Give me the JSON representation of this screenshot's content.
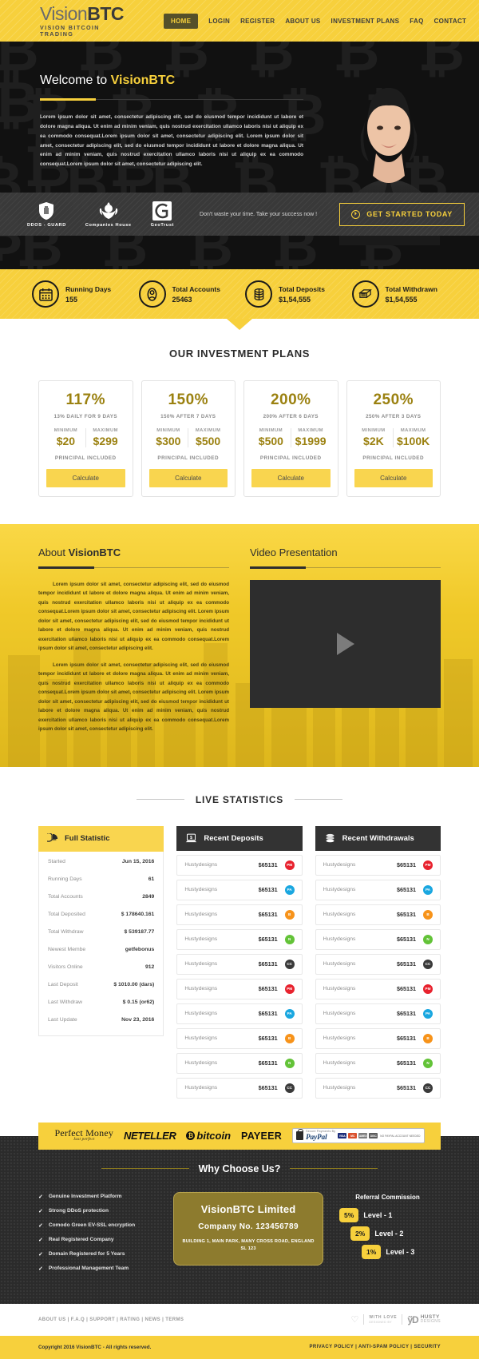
{
  "brand": {
    "logo_main_vision": "Vision",
    "logo_main_btc": "BTC",
    "logo_sub": "VISION BITCOIN TRADING",
    "accent": "#f7d03c",
    "dark": "#2b2b2b"
  },
  "nav": {
    "items": [
      {
        "label": "HOME",
        "active": true
      },
      {
        "label": "LOGIN",
        "active": false
      },
      {
        "label": "REGISTER",
        "active": false
      },
      {
        "label": "ABOUT US",
        "active": false
      },
      {
        "label": "INVESTMENT PLANS",
        "active": false
      },
      {
        "label": "FAQ",
        "active": false
      },
      {
        "label": "CONTACT",
        "active": false
      }
    ]
  },
  "hero": {
    "title_prefix": "Welcome to ",
    "title_brand": "VisionBTC",
    "paragraph": "Lorem ipsum dolor sit amet, consectetur adipiscing elit, sed do eiusmod tempor incididunt ut labore et dolore magna aliqua. Ut enim ad minim veniam, quis nostrud exercitation ullamco laboris nisi ut aliquip ex ea commodo consequat.Lorem ipsum dolor sit amet, consectetur adipiscing elit. Lorem ipsum dolor sit amet, consectetur adipiscing elit, sed do eiusmod tempor incididunt ut labore et dolore magna aliqua. Ut enim ad minim veniam, quis nostrud exercitation ullamco laboris nisi ut aliquip ex ea commodo consequat.Lorem ipsum dolor sit amet, consectetur adipiscing elit."
  },
  "trustbar": {
    "badges": [
      {
        "name": "DDOS - GUARD",
        "icon": "shield-icon"
      },
      {
        "name": "Companies House",
        "icon": "crest-icon"
      },
      {
        "name": "GeoTrust",
        "icon": "geotrust-icon"
      }
    ],
    "tagline": "Don't waste your time. Take your success now !",
    "cta_label": "GET STARTED TODAY"
  },
  "stats": [
    {
      "icon": "calendar-icon",
      "label": "Running Days",
      "value": "155"
    },
    {
      "icon": "user-icon",
      "label": "Total Accounts",
      "value": "25463"
    },
    {
      "icon": "coins-icon",
      "label": "Total Deposits",
      "value": "$1,54,555"
    },
    {
      "icon": "cash-stack-icon",
      "label": "Total Withdrawn",
      "value": "$1,54,555"
    }
  ],
  "plans_section": {
    "title": "OUR INVESTMENT PLANS",
    "min_label": "MINIMUM",
    "max_label": "MAXIMUM",
    "principal_label": "PRINCIPAL INCLUDED",
    "button_label": "Calculate",
    "plans": [
      {
        "percent": "117%",
        "desc": "13% DAILY FOR 9 DAYS",
        "min": "$20",
        "max": "$299"
      },
      {
        "percent": "150%",
        "desc": "150% AFTER 7 DAYS",
        "min": "$300",
        "max": "$500"
      },
      {
        "percent": "200%",
        "desc": "200% AFTER 6 DAYS",
        "min": "$500",
        "max": "$1999"
      },
      {
        "percent": "250%",
        "desc": "250% AFTER 3 DAYS",
        "min": "$2K",
        "max": "$100K"
      }
    ]
  },
  "about": {
    "heading_prefix": "About ",
    "heading_brand": "VisionBTC",
    "paragraph1": "Lorem ipsum dolor sit amet, consectetur adipiscing elit, sed do eiusmod tempor incididunt ut labore et dolore magna aliqua. Ut enim ad minim veniam, quis nostrud exercitation ullamco laboris nisi ut aliquip ex ea commodo consequat.Lorem ipsum dolor sit amet, consectetur adipiscing elit. Lorem ipsum dolor sit amet, consectetur adipiscing elit, sed do eiusmod tempor incididunt ut labore et dolore magna aliqua. Ut enim ad minim veniam, quis nostrud exercitation ullamco laboris nisi ut aliquip ex ea commodo consequat.Lorem ipsum dolor sit amet, consectetur adipiscing elit.",
    "paragraph2": "Lorem ipsum dolor sit amet, consectetur adipiscing elit, sed do eiusmod tempor incididunt ut labore et dolore magna aliqua. Ut enim ad minim veniam, quis nostrud exercitation ullamco laboris nisi ut aliquip ex ea commodo consequat.Lorem ipsum dolor sit amet, consectetur adipiscing elit. Lorem ipsum dolor sit amet, consectetur adipiscing elit, sed do eiusmod tempor incididunt ut labore et dolore magna aliqua. Ut enim ad minim veniam, quis nostrud exercitation ullamco laboris nisi ut aliquip ex ea commodo consequat.Lorem ipsum dolor sit amet, consectetur adipiscing elit.",
    "video_heading": "Video Presentation"
  },
  "live": {
    "title": "LIVE STATISTICS",
    "full_statistic": {
      "header": "Full Statistic",
      "icon": "pie-chart-icon",
      "rows": [
        {
          "key": "Started",
          "value": "Jun 15, 2016"
        },
        {
          "key": "Running Days",
          "value": "61"
        },
        {
          "key": "Total Accounts",
          "value": "2849"
        },
        {
          "key": "Total Deposited",
          "value": "$ 178640.161"
        },
        {
          "key": "Total Withdraw",
          "value": "$ 539187.77"
        },
        {
          "key": "Newest Membe",
          "value": "getfebonus"
        },
        {
          "key": "Visitors Online",
          "value": "912"
        },
        {
          "key": "Last Deposit",
          "value": "$ 1010.00 (dars)"
        },
        {
          "key": "Last Withdraw",
          "value": "$ 0.15 (or62)"
        },
        {
          "key": "Last Update",
          "value": "Nov 23, 2016"
        }
      ]
    },
    "recent_deposits": {
      "header": "Recent Deposits",
      "icon": "laptop-dollar-icon",
      "rows": [
        {
          "name": "Hustydesigns",
          "amount": "$65131",
          "badge": "PM",
          "color": "#e8222e"
        },
        {
          "name": "Hustydesigns",
          "amount": "$65131",
          "badge": "PA",
          "color": "#1aa7e0"
        },
        {
          "name": "Hustydesigns",
          "amount": "$65131",
          "badge": "B",
          "color": "#f7931a"
        },
        {
          "name": "Hustydesigns",
          "amount": "$65131",
          "badge": "N",
          "color": "#63c338"
        },
        {
          "name": "Hustydesigns",
          "amount": "$65131",
          "badge": "CC",
          "color": "#3a3a3a"
        },
        {
          "name": "Hustydesigns",
          "amount": "$65131",
          "badge": "PM",
          "color": "#e8222e"
        },
        {
          "name": "Hustydesigns",
          "amount": "$65131",
          "badge": "PA",
          "color": "#1aa7e0"
        },
        {
          "name": "Hustydesigns",
          "amount": "$65131",
          "badge": "B",
          "color": "#f7931a"
        },
        {
          "name": "Hustydesigns",
          "amount": "$65131",
          "badge": "N",
          "color": "#63c338"
        },
        {
          "name": "Hustydesigns",
          "amount": "$65131",
          "badge": "CC",
          "color": "#3a3a3a"
        }
      ]
    },
    "recent_withdrawals": {
      "header": "Recent Withdrawals",
      "icon": "coins-stack-icon",
      "rows": [
        {
          "name": "Hustydesigns",
          "amount": "$65131",
          "badge": "PM",
          "color": "#e8222e"
        },
        {
          "name": "Hustydesigns",
          "amount": "$65131",
          "badge": "PA",
          "color": "#1aa7e0"
        },
        {
          "name": "Hustydesigns",
          "amount": "$65131",
          "badge": "B",
          "color": "#f7931a"
        },
        {
          "name": "Hustydesigns",
          "amount": "$65131",
          "badge": "N",
          "color": "#63c338"
        },
        {
          "name": "Hustydesigns",
          "amount": "$65131",
          "badge": "CC",
          "color": "#3a3a3a"
        },
        {
          "name": "Hustydesigns",
          "amount": "$65131",
          "badge": "PM",
          "color": "#e8222e"
        },
        {
          "name": "Hustydesigns",
          "amount": "$65131",
          "badge": "PA",
          "color": "#1aa7e0"
        },
        {
          "name": "Hustydesigns",
          "amount": "$65131",
          "badge": "B",
          "color": "#f7931a"
        },
        {
          "name": "Hustydesigns",
          "amount": "$65131",
          "badge": "N",
          "color": "#63c338"
        },
        {
          "name": "Hustydesigns",
          "amount": "$65131",
          "badge": "CC",
          "color": "#3a3a3a"
        }
      ]
    }
  },
  "payments": {
    "perfect_money_l1": "Perfect Money",
    "perfect_money_l2": "Just perfect",
    "neteller": "NETELLER",
    "bitcoin": "bitcoin",
    "payeer": "PAYEER",
    "paypal_small": "Secure Payments By",
    "paypal": "PayPal",
    "paypal_note": "NO PAYPAL ACCOUNT NEEDED",
    "cards": [
      "VISA",
      "MC",
      "AMEX",
      "DISC"
    ]
  },
  "why": {
    "title": "Why Choose Us?",
    "features": [
      "Genuine Investment Platform",
      "Strong DDoS protection",
      "Comodo Green EV-SSL encryption",
      "Real Registered Company",
      "Domain Registered for 5 Years",
      "Professional Management Team"
    ],
    "company": {
      "name": "VisionBTC Limited",
      "company_no": "Company No. 123456789",
      "address": "BUILDING 1, MAIN PARK, MANY CROSS ROAD, ENGLAND SL 123"
    },
    "referral": {
      "title": "Referral Commission",
      "levels": [
        {
          "percent": "5%",
          "label": "Level - 1"
        },
        {
          "percent": "2%",
          "label": "Level - 2"
        },
        {
          "percent": "1%",
          "label": "Level - 3"
        }
      ]
    }
  },
  "footer": {
    "links": "ABOUT US  |  F.A.Q  |  SUPPORT  |  RATING  |  NEWS  |  TERMS",
    "with_love": "WITH LOVE",
    "designed_by": "DESIGNED BY",
    "husty_1": "HUSTY",
    "husty_2": "DESIGNS",
    "copyright": "Copyright 2016 VisionBTC - All rights reserved.",
    "policy_links": "PRIVACY POLICY   |   ANTI-SPAM POLICY   |   SECURITY"
  }
}
